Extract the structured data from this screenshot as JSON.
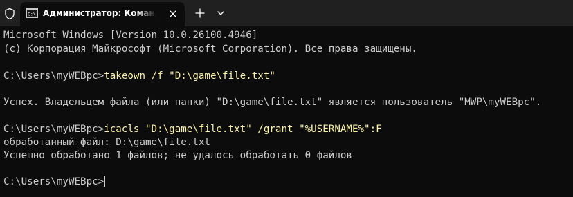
{
  "window": {
    "tab_title": "Администратор: Командная строка",
    "accent": "#f9f1a5",
    "text_color": "#cccccc",
    "background": "#0c0c0c",
    "titlebar_background": "#202020"
  },
  "icons": {
    "shield": "shield-icon",
    "tab": "cmd-icon",
    "close": "close-icon",
    "new_tab": "plus-icon",
    "dropdown": "chevron-down-icon"
  },
  "terminal": {
    "header_line1": "Microsoft Windows [Version 10.0.26100.4946]",
    "header_line2": "(c) Корпорация Майкрософт (Microsoft Corporation). Все права защищены.",
    "prompt1": "C:\\Users\\myWEBpc>",
    "command1": "takeown /f \"D:\\game\\file.txt\"",
    "output1": "Успех. Владельцем файла (или папки) \"D:\\game\\file.txt\" является пользователь \"MWP\\myWEBpc\".",
    "prompt2": "C:\\Users\\myWEBpc>",
    "command2": "icacls \"D:\\game\\file.txt\" /grant \"%USERNAME%\":F",
    "output2_line1": "обработанный файл: D:\\game\\file.txt",
    "output2_line2": "Успешно обработано 1 файлов; не удалось обработать 0 файлов",
    "prompt3": "C:\\Users\\myWEBpc>"
  }
}
